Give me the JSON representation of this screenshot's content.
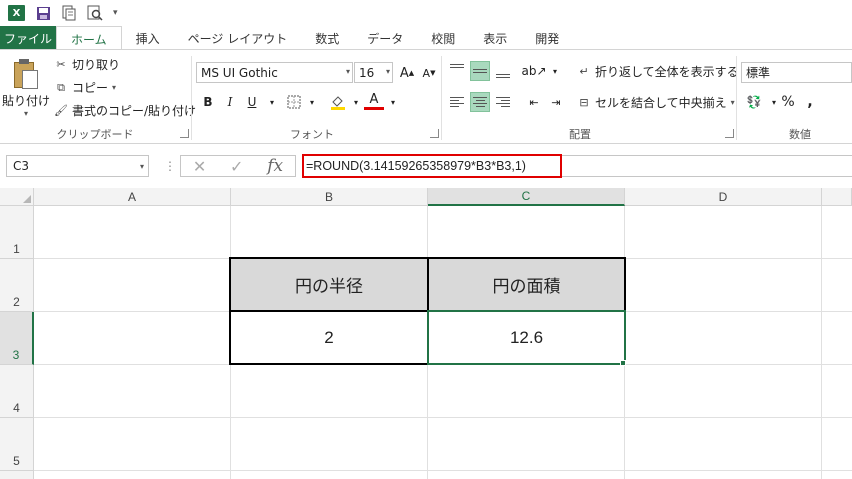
{
  "tabs": {
    "file": "ファイル",
    "items": [
      "ホーム",
      "挿入",
      "ページ レイアウト",
      "数式",
      "データ",
      "校閲",
      "表示",
      "開発"
    ]
  },
  "clipboard": {
    "paste": "貼り付け",
    "cut": "切り取り",
    "copy": "コピー",
    "format_painter": "書式のコピー/貼り付け",
    "group_label": "クリップボード"
  },
  "font": {
    "name": "MS UI Gothic",
    "size": "16",
    "bold": "B",
    "italic": "I",
    "underline": "U",
    "group_label": "フォント",
    "grow": "A",
    "shrink": "A",
    "color": "A"
  },
  "alignment": {
    "wrap_text": "折り返して全体を表示する",
    "merge_center": "セルを結合して中央揃え",
    "group_label": "配置"
  },
  "number": {
    "format": "標準",
    "percent": "%",
    "comma": ",",
    "group_label": "数値"
  },
  "formula_bar": {
    "name_box": "C3",
    "formula": "=ROUND(3.14159265358979*B3*B3,1)",
    "fx": "fx"
  },
  "grid": {
    "columns": [
      "A",
      "B",
      "C",
      "D"
    ],
    "rows": [
      "1",
      "2",
      "3",
      "4",
      "5"
    ],
    "selected_cell": "C3",
    "cells": {
      "B2": "円の半径",
      "C2": "円の面積",
      "B3": "2",
      "C3": "12.6"
    }
  },
  "colors": {
    "accent": "#217346",
    "highlight": "#e00000",
    "header_fill": "#d9d9d9"
  }
}
